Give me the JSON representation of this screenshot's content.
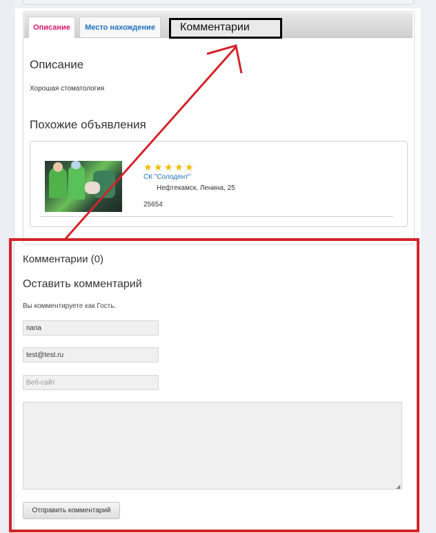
{
  "tabs": {
    "description": "Описание",
    "location": "Место нахождение",
    "comments_callout": "Комментарии"
  },
  "description": {
    "heading": "Описание",
    "text": "Хорошая стоматология"
  },
  "similar": {
    "heading": "Похожие объявления",
    "rating": 5,
    "company": "СК \"Солодент\"",
    "address": "Нефтекамск, Ленина, 25",
    "price": "25654"
  },
  "comments": {
    "count_title": "Комментарии (0)",
    "leave_title": "Оставить комментарий",
    "as_guest": "Вы комментируете как Гость.",
    "name_value": "папа",
    "email_value": "test@test.ru",
    "website_placeholder": "Веб-сайт",
    "submit_label": "Отправить комментарий"
  },
  "annotation": {
    "callout_border": "#000000",
    "arrow_color": "#d2232a",
    "highlight_color": "#d2232a"
  }
}
